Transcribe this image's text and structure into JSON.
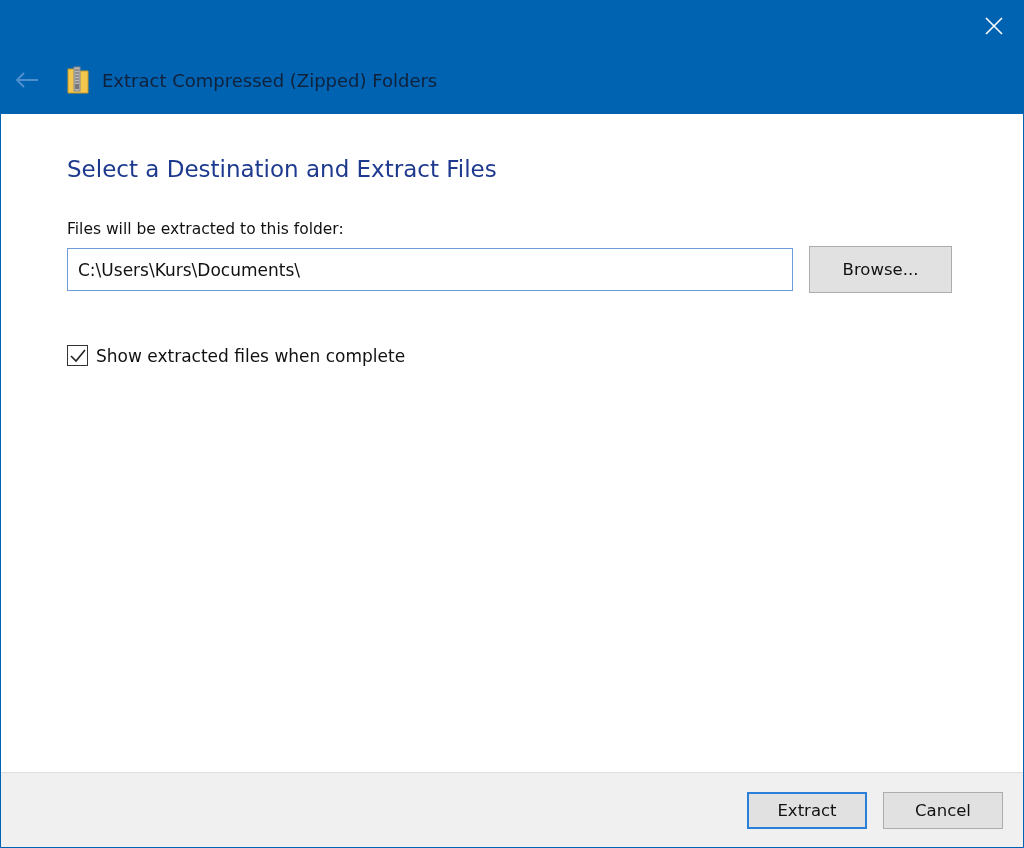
{
  "window": {
    "title": "Extract Compressed (Zipped) Folders",
    "back_disabled": true
  },
  "heading": "Select a Destination and Extract Files",
  "destination": {
    "label": "Files will be extracted to this folder:",
    "value": "C:\\Users\\Kurs\\Documents\\",
    "browse": "Browse..."
  },
  "option": {
    "label": "Show extracted files when complete",
    "checked": true
  },
  "buttons": [
    {
      "label": "Extract",
      "default": true
    },
    {
      "label": "Cancel",
      "default": false
    }
  ]
}
